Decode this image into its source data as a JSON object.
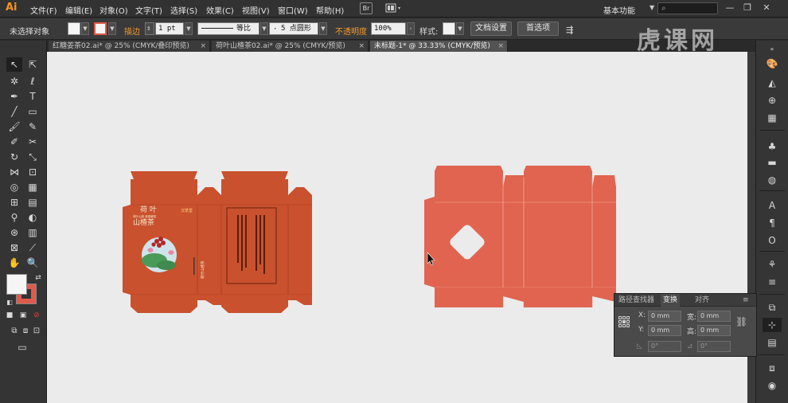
{
  "app": {
    "logo": "Ai"
  },
  "menu": {
    "items": [
      "文件(F)",
      "编辑(E)",
      "对象(O)",
      "文字(T)",
      "选择(S)",
      "效果(C)",
      "视图(V)",
      "窗口(W)",
      "帮助(H)"
    ],
    "bridge_label": "Br",
    "workspace": "基本功能",
    "window_controls": {
      "minimize": "—",
      "restore": "❐",
      "close": "✕"
    }
  },
  "control_bar": {
    "selection_status": "未选择对象",
    "stroke_label": "描边",
    "stroke_weight": "1 pt",
    "stroke_profile": "等比",
    "brush": "5 点圆形",
    "opacity_label": "不透明度",
    "opacity_value": "100%",
    "style_label": "样式:",
    "doc_setup_button": "文档设置",
    "preferences_button": "首选项"
  },
  "tabs": [
    {
      "label": "红糖姜茶02.ai* @ 25% (CMYK/叠印预览)",
      "active": false
    },
    {
      "label": "荷叶山楂茶02.ai* @ 25% (CMYK/预览)",
      "active": false
    },
    {
      "label": "未标题-1* @ 33.33% (CMYK/预览)",
      "active": true
    }
  ],
  "artwork": {
    "left_box": {
      "title_line1": "荷 叶",
      "title_line2": "山楂茶",
      "subtitle": "荷叶山楂 清香解腻",
      "brand": "汉草堂",
      "side_label": "荷叶山楂茶"
    }
  },
  "transform_panel": {
    "tabs": [
      "路径查找器",
      "变换",
      "对齐"
    ],
    "active_tab": "变换",
    "x_label": "X:",
    "x_value": "0 mm",
    "y_label": "Y:",
    "y_value": "0 mm",
    "w_label": "宽:",
    "w_value": "0 mm",
    "h_label": "高:",
    "h_value": "0 mm",
    "rotate_value": "0°",
    "shear_value": "0°"
  },
  "colors": {
    "box_dark_orange": "#c9512e",
    "box_coral": "#e06450",
    "canvas": "#ebebeb",
    "accent": "#f39a2a"
  },
  "watermark": {
    "text": "虎课网"
  }
}
